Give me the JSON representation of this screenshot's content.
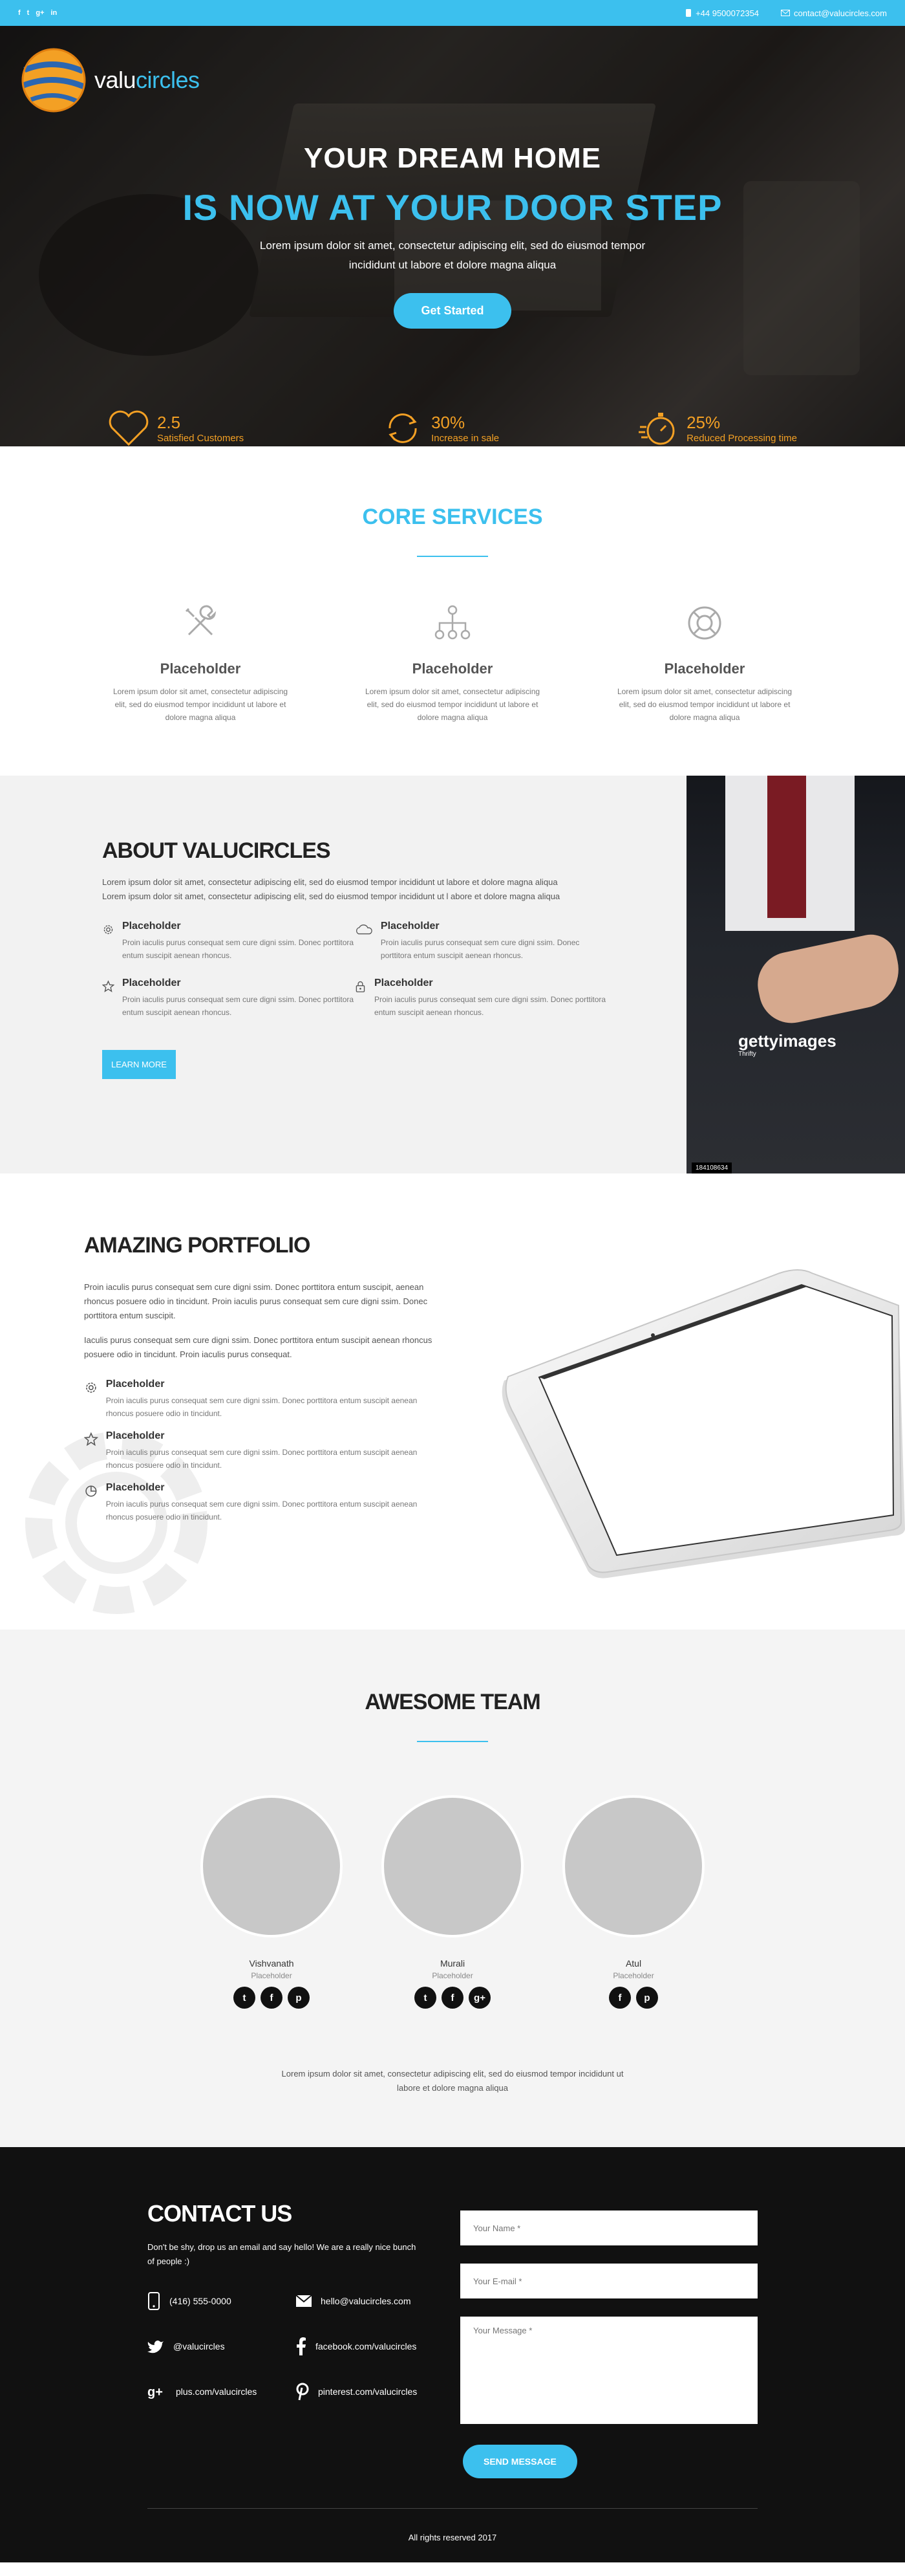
{
  "topbar": {
    "social": [
      "f",
      "t",
      "g+",
      "in"
    ],
    "phone": "+44 9500072354",
    "email": "contact@valucircles.com",
    "accent": "#3cc0ee"
  },
  "brand": {
    "logo_prefix": "valu",
    "logo_suffix": "circles",
    "accent": "#3cc0ee",
    "orange": "#f3a024"
  },
  "hero": {
    "title_line1": "YOUR DREAM HOME",
    "title_line2": "IS NOW AT YOUR DOOR STEP",
    "subtitle": "Lorem ipsum dolor sit amet, consectetur adipiscing elit, sed do eiusmod tempor incididunt ut labore et dolore magna aliqua",
    "cta": "Get Started",
    "stats": [
      {
        "icon": "heart-icon",
        "value": "2.5",
        "label": "Satisfied Customers"
      },
      {
        "icon": "refresh-icon",
        "value": "30%",
        "label": "Increase in sale"
      },
      {
        "icon": "stopwatch-icon",
        "value": "25%",
        "label": "Reduced Processing time"
      }
    ]
  },
  "core": {
    "title": "CORE SERVICES",
    "items": [
      {
        "icon": "tools-icon",
        "title": "Placeholder",
        "text": "Lorem ipsum dolor sit amet, consectetur adipiscing elit, sed do eiusmod tempor incididunt ut labore et dolore magna aliqua"
      },
      {
        "icon": "hierarchy-icon",
        "title": "Placeholder",
        "text": "Lorem ipsum dolor sit amet, consectetur adipiscing elit, sed do eiusmod tempor incididunt ut labore et dolore magna aliqua"
      },
      {
        "icon": "lifebuoy-icon",
        "title": "Placeholder",
        "text": "Lorem ipsum dolor sit amet, consectetur adipiscing elit, sed do eiusmod tempor incididunt ut labore et dolore magna aliqua"
      }
    ]
  },
  "about": {
    "title": "ABOUT VALUCIRCLES",
    "text": "Lorem ipsum dolor sit amet, consectetur adipiscing elit, sed do eiusmod tempor incididunt ut labore et dolore magna aliqua Lorem ipsum dolor sit amet, consectetur adipiscing elit, sed do eiusmod tempor incididunt ut l abore et dolore magna aliqua",
    "features": [
      {
        "icon": "gear-icon",
        "title": "Placeholder",
        "text": "Proin iaculis purus consequat sem cure digni ssim. Donec porttitora entum suscipit aenean rhoncus."
      },
      {
        "icon": "cloud-icon",
        "title": "Placeholder",
        "text": "Proin iaculis purus consequat sem cure digni ssim. Donec porttitora entum suscipit aenean rhoncus."
      },
      {
        "icon": "star-icon",
        "title": "Placeholder",
        "text": "Proin iaculis purus consequat sem cure digni ssim. Donec porttitora entum suscipit aenean rhoncus."
      },
      {
        "icon": "lock-icon",
        "title": "Placeholder",
        "text": "Proin iaculis purus consequat sem cure digni ssim. Donec porttitora entum suscipit aenean rhoncus."
      }
    ],
    "button": "LEARN MORE",
    "photo": {
      "watermark": "gettyimages",
      "credit": "Thrifty",
      "id": "184108634"
    }
  },
  "portfolio": {
    "title": "AMAZING PORTFOLIO",
    "p1": "Proin iaculis purus consequat sem cure digni ssim. Donec porttitora entum suscipit, aenean rhoncus posuere odio in tincidunt. Proin iaculis purus consequat sem cure digni ssim. Donec porttitora entum suscipit.",
    "p2": "Iaculis purus consequat sem cure digni ssim. Donec porttitora entum suscipit aenean rhoncus posuere odio in tincidunt. Proin iaculis purus consequat.",
    "features": [
      {
        "icon": "gear-icon",
        "title": "Placeholder",
        "text": "Proin iaculis purus consequat sem cure digni ssim. Donec porttitora entum suscipit aenean rhoncus posuere odio in tincidunt."
      },
      {
        "icon": "star-icon",
        "title": "Placeholder",
        "text": "Proin iaculis purus consequat sem cure digni ssim. Donec porttitora entum suscipit aenean rhoncus posuere odio in tincidunt."
      },
      {
        "icon": "pie-chart-icon",
        "title": "Placeholder",
        "text": "Proin iaculis purus consequat sem cure digni ssim. Donec porttitora entum suscipit aenean rhoncus posuere odio in tincidunt."
      }
    ]
  },
  "team": {
    "title": "AWESOME TEAM",
    "members": [
      {
        "name": "Vishvanath",
        "role": "Placeholder",
        "social": [
          "t",
          "f",
          "p"
        ]
      },
      {
        "name": "Murali",
        "role": "Placeholder",
        "social": [
          "t",
          "f",
          "g+"
        ]
      },
      {
        "name": "Atul",
        "role": "Placeholder",
        "social": [
          "f",
          "p"
        ]
      }
    ],
    "footer_text": "Lorem ipsum dolor sit amet, consectetur adipiscing elit, sed do eiusmod tempor incididunt ut labore et dolore magna aliqua"
  },
  "contact": {
    "title": "CONTACT US",
    "intro": "Don't be shy, drop us an email and say hello! We are a really nice bunch of people :)",
    "items": [
      {
        "icon": "phone-icon",
        "text": "(416) 555-0000"
      },
      {
        "icon": "mail-icon",
        "text": "hello@valucircles.com"
      },
      {
        "icon": "twitter-icon",
        "text": "@valucircles"
      },
      {
        "icon": "facebook-icon",
        "text": "facebook.com/valucircles"
      },
      {
        "icon": "googleplus-icon",
        "text": "plus.com/valucircles"
      },
      {
        "icon": "pinterest-icon",
        "text": "pinterest.com/valucircles"
      }
    ],
    "form": {
      "name_placeholder": "Your Name *",
      "email_placeholder": "Your E-mail *",
      "message_placeholder": "Your Message *",
      "submit": "SEND MESSAGE"
    },
    "copyright": "All rights reserved 2017"
  }
}
